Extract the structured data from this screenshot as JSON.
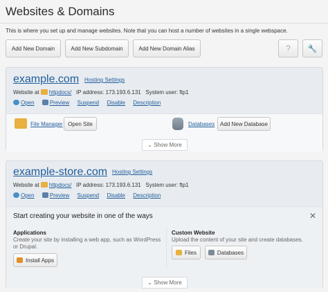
{
  "page": {
    "title": "Websites & Domains",
    "intro": "This is where you set up and manage websites. Note that you can host a number of websites in a single webspace."
  },
  "toolbar": {
    "add_domain": "Add New Domain",
    "add_subdomain": "Add New Subdomain",
    "add_alias": "Add New Domain Alias",
    "help_icon": "?",
    "tools_icon": "🔧"
  },
  "domains": [
    {
      "name": "example.com",
      "hosting_settings": "Hosting Settings",
      "website_at_label": "Website at",
      "website_folder": "httpdocs/",
      "ip_label": "IP address: 173.193.6.131",
      "user_label": "System user: ftp1",
      "actions": {
        "open": "Open",
        "preview": "Preview",
        "suspend": "Suspend",
        "disable": "Disable",
        "description": "Description"
      },
      "file_manager": "File Manager",
      "open_site": "Open Site",
      "databases": "Databases",
      "add_database": "Add New Database",
      "show_more": "⌄ Show More"
    },
    {
      "name": "example-store.com",
      "hosting_settings": "Hosting Settings",
      "website_at_label": "Website at",
      "website_folder": "httpdocs/",
      "ip_label": "IP address: 173.193.6.131",
      "user_label": "System user: ftp1",
      "actions": {
        "open": "Open",
        "preview": "Preview",
        "suspend": "Suspend",
        "disable": "Disable",
        "description": "Description"
      },
      "start_title": "Start creating your website in one of the ways",
      "close": "✕",
      "applications": {
        "heading": "Applications",
        "desc": "Create your site by installing a web app, such as WordPress or Drupal.",
        "install_apps": "Install Apps"
      },
      "custom": {
        "heading": "Custom Website",
        "desc": "Upload the content of your site and create databases.",
        "files": "Files",
        "databases": "Databases"
      },
      "show_more": "⌄ Show More"
    }
  ]
}
